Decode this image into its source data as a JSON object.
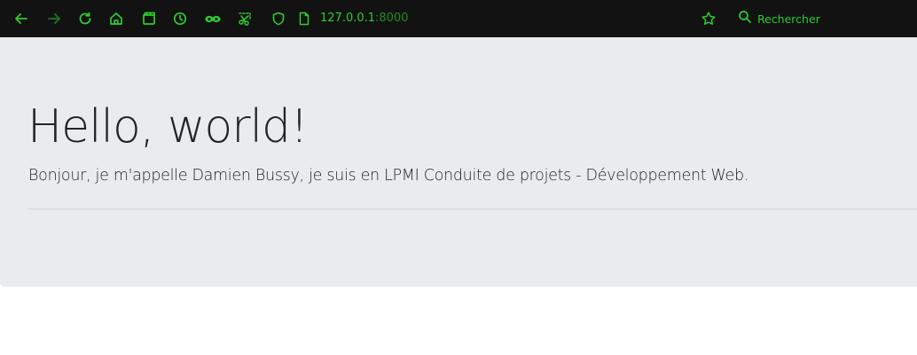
{
  "browser": {
    "url": {
      "host": "127.0.0.1",
      "port": ":8000"
    },
    "search_label": "Rechercher",
    "accent_color": "#2ecc2e",
    "toolbar_background": "#121212",
    "icons": [
      "back-arrow-icon",
      "forward-arrow-icon",
      "reload-icon",
      "home-icon",
      "clapperboard-icon",
      "history-clock-icon",
      "infinity-mask-icon",
      "screenshot-scissors-icon",
      "shield-icon",
      "page-icon",
      "star-icon",
      "search-icon"
    ]
  },
  "page": {
    "title": "Hello, world!",
    "lead": "Bonjour, je m'appelle Damien Bussy, je suis en LPMI Conduite de projets - Développement Web.",
    "jumbotron_background": "#e9ecef"
  }
}
